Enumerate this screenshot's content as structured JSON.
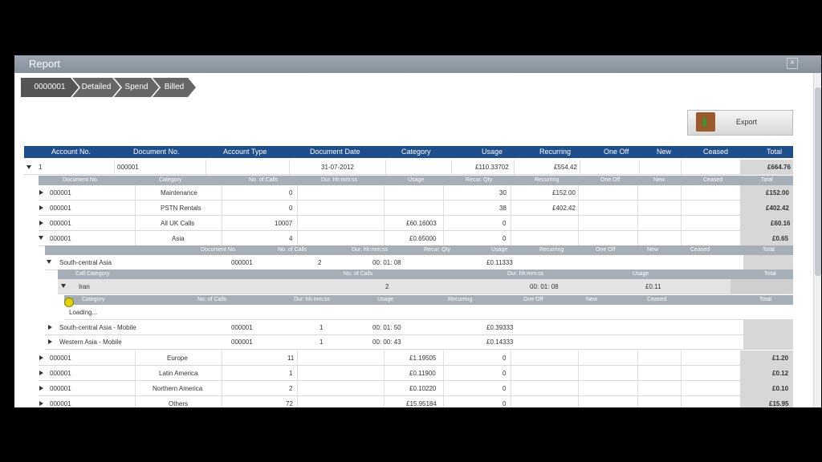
{
  "window": {
    "title": "Report",
    "close_label": "×"
  },
  "breadcrumb": [
    "0000001",
    "Detailed",
    "Spend",
    "Billed"
  ],
  "export": {
    "label": "Export"
  },
  "main_headers": [
    "Account No.",
    "Document No.",
    "Account Type",
    "Document Date",
    "Category",
    "Usage",
    "Recurring",
    "One Off",
    "New",
    "Ceased",
    "Total"
  ],
  "account_row": {
    "account_no": "1",
    "document_no": "000001",
    "document_date": "31-07-2012",
    "usage": "£110.33702",
    "recurring": "£554.42",
    "total": "£664.76"
  },
  "doc_headers": [
    "Document No.",
    "Category",
    "No. of Calls",
    "Dur. hh:mm:ss",
    "Usage",
    "Recur. Qty",
    "Recurring",
    "One Off",
    "New",
    "Ceased",
    "Total"
  ],
  "doc_rows": [
    {
      "doc": "000001",
      "category": "Maintenance",
      "calls": "0",
      "usage": "",
      "qty": "30",
      "recurring": "£152.00",
      "total": "£152.00"
    },
    {
      "doc": "000001",
      "category": "PSTN Rentals",
      "calls": "0",
      "usage": "",
      "qty": "38",
      "recurring": "£402.42",
      "total": "£402.42"
    },
    {
      "doc": "000001",
      "category": "All UK Calls",
      "calls": "10007",
      "usage": "£60.16003",
      "qty": "0",
      "recurring": "",
      "total": "£60.16"
    },
    {
      "doc": "000001",
      "category": "Asia",
      "calls": "4",
      "usage": "£0.65000",
      "qty": "0",
      "recurring": "",
      "total": "£0.65"
    }
  ],
  "asia_headers": [
    "Document No.",
    "No. of Calls",
    "Dur. hh:mm:ss",
    "Recur. Qty",
    "Usage",
    "Recurring",
    "One Off",
    "New",
    "Ceased",
    "Total"
  ],
  "asia_rows": [
    {
      "name": "South-central Asia",
      "doc": "000001",
      "calls": "2",
      "dur": "00: 01: 08",
      "usage": "£0.11333"
    },
    {
      "name": "South-central Asia - Mobile",
      "doc": "000001",
      "calls": "1",
      "dur": "00: 01: 50",
      "usage": "£0.39333"
    },
    {
      "name": "Western Asia - Mobile",
      "doc": "000001",
      "calls": "1",
      "dur": "00: 00: 43",
      "usage": "£0.14333"
    }
  ],
  "callcat_headers": [
    "Call Category",
    "No. of Calls",
    "Dur. hh:mm:ss",
    "Usage",
    "Total"
  ],
  "callcat_row": {
    "name": "Iran",
    "calls": "2",
    "dur": "00: 01: 08",
    "usage": "£0.11"
  },
  "detail_headers": [
    "Category",
    "No. of Calls",
    "Dur. hh:mm:ss",
    "Usage",
    "Recurring",
    "One Off",
    "New",
    "Ceased",
    "Total"
  ],
  "loading_text": "Loading...",
  "bottom_rows": [
    {
      "doc": "000001",
      "category": "Europe",
      "calls": "11",
      "usage": "£1.19505",
      "qty": "0",
      "total": "£1.20"
    },
    {
      "doc": "000001",
      "category": "Latin America",
      "calls": "1",
      "usage": "£0.11900",
      "qty": "0",
      "total": "£0.12"
    },
    {
      "doc": "000001",
      "category": "Northern America",
      "calls": "2",
      "usage": "£0.10220",
      "qty": "0",
      "total": "£0.10"
    },
    {
      "doc": "000001",
      "category": "Others",
      "calls": "72",
      "usage": "£15.95184",
      "qty": "0",
      "total": "£15.95"
    }
  ]
}
